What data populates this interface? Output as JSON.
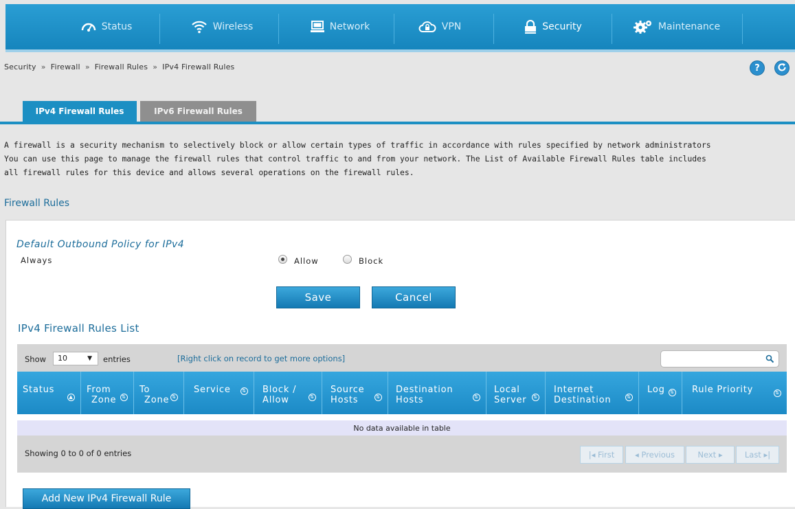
{
  "nav": {
    "items": [
      {
        "label": "Status",
        "icon": "gauge-icon"
      },
      {
        "label": "Wireless",
        "icon": "wifi-icon"
      },
      {
        "label": "Network",
        "icon": "monitor-icon"
      },
      {
        "label": "VPN",
        "icon": "cloud-lock-icon"
      },
      {
        "label": "Security",
        "icon": "lock-icon",
        "active": true
      },
      {
        "label": "Maintenance",
        "icon": "gears-icon"
      }
    ]
  },
  "breadcrumb": [
    "Security",
    "Firewall",
    "Firewall Rules",
    "IPv4 Firewall Rules"
  ],
  "breadcrumb_sep": "»",
  "help_label": "?",
  "tabs": [
    {
      "label": "IPv4 Firewall Rules",
      "active": true
    },
    {
      "label": "IPv6 Firewall Rules",
      "active": false
    }
  ],
  "intro": [
    "A firewall is a security mechanism to selectively block or allow certain types of traffic in accordance with rules specified by network administrators",
    "You can use this page to manage the firewall rules that control traffic to and from your network. The List of Available Firewall Rules table includes",
    "all firewall rules for this device and allows several operations on the firewall rules."
  ],
  "section_title": "Firewall Rules",
  "policy": {
    "title": "Default Outbound Policy for IPv4",
    "label": "Always",
    "options": [
      {
        "label": "Allow",
        "selected": true
      },
      {
        "label": "Block",
        "selected": false
      }
    ]
  },
  "buttons": {
    "save": "Save",
    "cancel": "Cancel",
    "add": "Add New IPv4 Firewall Rule"
  },
  "list": {
    "title": "IPv4 Firewall Rules List",
    "show_label": "Show",
    "entries_value": "10",
    "entries_label": "entries",
    "hint": "[Right click on record to get more options]",
    "search_value": "",
    "columns": [
      [
        "Status"
      ],
      [
        "From",
        "Zone"
      ],
      [
        "To",
        "Zone"
      ],
      [
        "Service"
      ],
      [
        "Block /",
        "Allow"
      ],
      [
        "Source",
        "Hosts"
      ],
      [
        "Destination",
        "Hosts"
      ],
      [
        "Local",
        "Server"
      ],
      [
        "Internet",
        "Destination"
      ],
      [
        "Log"
      ],
      [
        "Rule Priority"
      ]
    ],
    "empty_text": "No data available in table",
    "info": "Showing 0 to 0 of 0 entries",
    "pagination": {
      "first": "First",
      "previous": "Previous",
      "next": "Next",
      "last": "Last"
    }
  },
  "colors": {
    "nav_bg": "#1c8fc3",
    "accent": "#1c8fc3",
    "title_text": "#1b6c9a",
    "button": "#2189c4"
  }
}
